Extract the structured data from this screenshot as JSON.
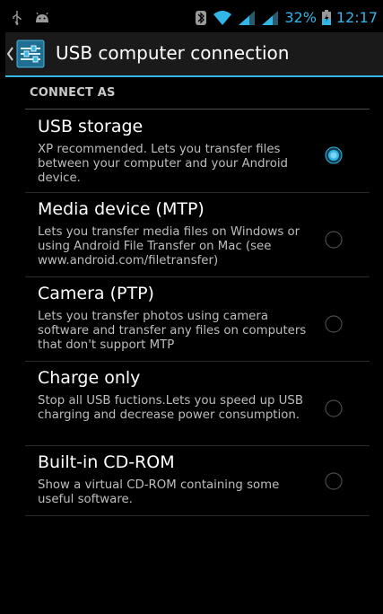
{
  "status_bar": {
    "battery": "32%",
    "time": "12:17",
    "icons": [
      "usb-icon",
      "android-debug-icon",
      "bluetooth-icon",
      "wifi-icon",
      "signal-icon",
      "signal-icon",
      "battery-charging-icon"
    ]
  },
  "action_bar": {
    "title": "USB computer connection",
    "icon": "settings-sliders-icon"
  },
  "section": {
    "header": "CONNECT AS"
  },
  "options": [
    {
      "title": "USB storage",
      "description": "XP recommended. Lets you transfer files between your computer and your Android device.",
      "selected": true
    },
    {
      "title": "Media device (MTP)",
      "description": "Lets you transfer media files on Windows or using Android File Transfer on Mac (see www.android.com/filetransfer)",
      "selected": false
    },
    {
      "title": "Camera (PTP)",
      "description": "Lets you transfer photos using camera software and transfer any files on computers that don't support MTP",
      "selected": false
    },
    {
      "title": "Charge only",
      "description": "Stop all USB fuctions.Lets you speed up USB charging and decrease power consumption.",
      "selected": false
    },
    {
      "title": "Built-in CD-ROM",
      "description": "Show a virtual CD-ROM containing some useful software.",
      "selected": false
    }
  ],
  "colors": {
    "accent": "#33b5e5",
    "background": "#000000",
    "action_bar": "#1a1a1a"
  }
}
